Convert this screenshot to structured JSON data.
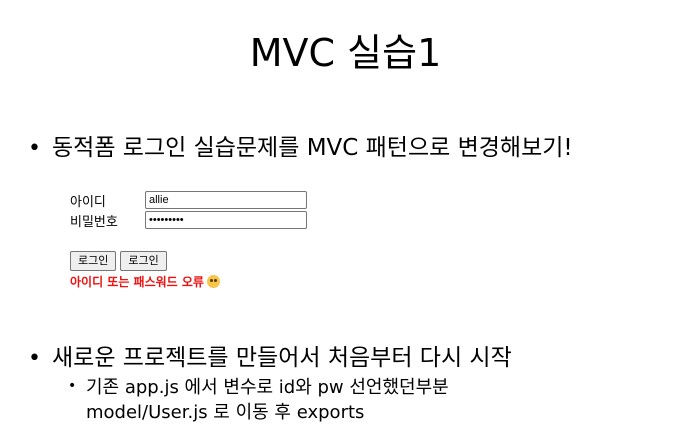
{
  "slide": {
    "title": "MVC 실습1",
    "bullet_symbol": "•",
    "sub_bullet_symbol": "•",
    "bullets": [
      {
        "text": "동적폼 로그인 실습문제를 MVC 패턴으로 변경해보기!"
      },
      {
        "text": "새로운 프로젝트를 만들어서 처음부터 다시 시작"
      }
    ],
    "sub_bullet": {
      "line1": "기존 app.js 에서 변수로 id와 pw 선언했던부분",
      "line2": "model/User.js 로 이동 후 exports"
    }
  },
  "login_demo": {
    "id_label": "아이디",
    "id_value": "allie",
    "pw_label": "비밀번호",
    "pw_value": "•••••••••",
    "button1_label": "로그인",
    "button2_label": "로그인",
    "error_text": "아이디 또는 패스워드 오류",
    "error_icon": "flushed-face-emoji-icon",
    "error_color": "#ee1111"
  }
}
